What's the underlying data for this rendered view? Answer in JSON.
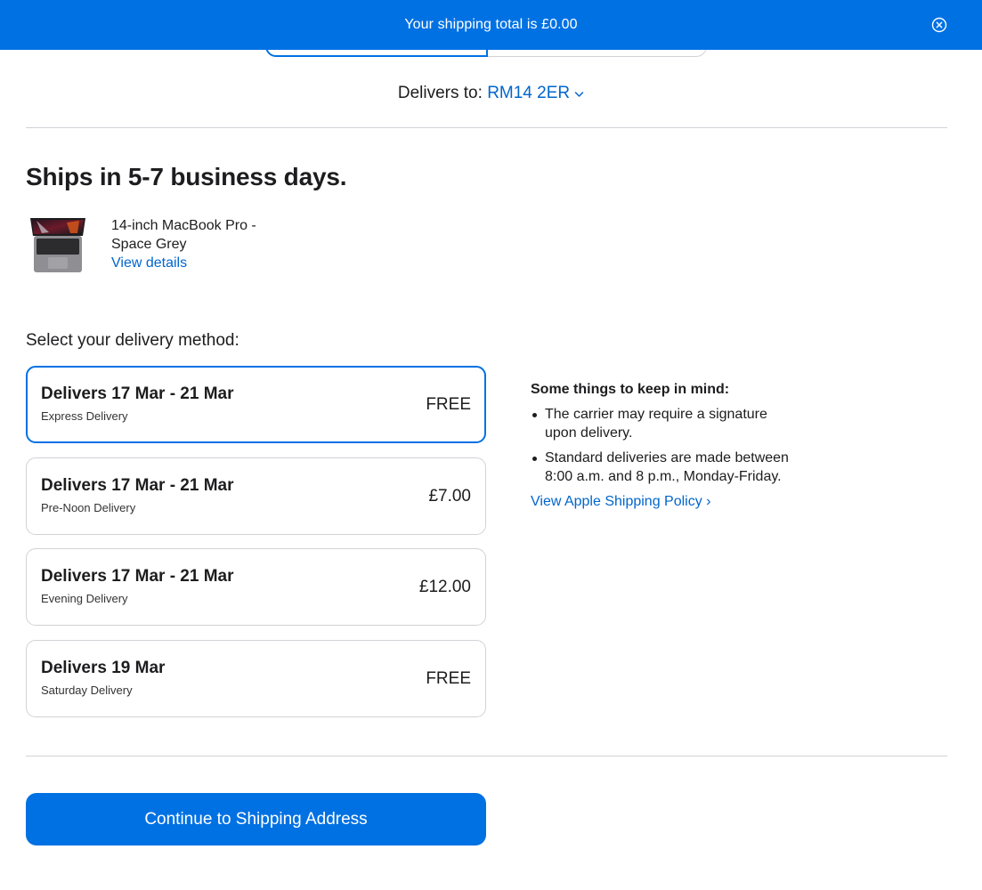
{
  "banner": {
    "message": "Your shipping total is £0.00",
    "close_icon": "close-circle-icon"
  },
  "location": {
    "label": "Delivers to:",
    "postcode": "RM14 2ER",
    "chevron_icon": "chevron-down-icon"
  },
  "shipping": {
    "title": "Ships in 5-7 business days.",
    "product": {
      "name": "14-inch MacBook Pro - Space Grey",
      "details_link": "View details",
      "image_icon": "macbook-pro-image"
    }
  },
  "delivery": {
    "select_label": "Select your delivery method:",
    "options": [
      {
        "title": "Delivers 17 Mar - 21 Mar",
        "method": "Express Delivery",
        "price": "FREE",
        "selected": true
      },
      {
        "title": "Delivers 17 Mar - 21 Mar",
        "method": "Pre-Noon Delivery",
        "price": "£7.00",
        "selected": false
      },
      {
        "title": "Delivers 17 Mar - 21 Mar",
        "method": "Evening Delivery",
        "price": "£12.00",
        "selected": false
      },
      {
        "title": "Delivers 19 Mar",
        "method": "Saturday Delivery",
        "price": "FREE",
        "selected": false
      }
    ]
  },
  "notes": {
    "title": "Some things to keep in mind:",
    "items": [
      "The carrier may require a signature upon delivery.",
      "Standard deliveries are made between 8:00 a.m. and 8 p.m., Monday-Friday."
    ],
    "policy_link": "View Apple Shipping Policy ›"
  },
  "actions": {
    "continue_label": "Continue to Shipping Address"
  },
  "colors": {
    "accent": "#0071e3",
    "link": "#0066cc",
    "text": "#1d1d1f",
    "border": "#d2d2d7"
  }
}
